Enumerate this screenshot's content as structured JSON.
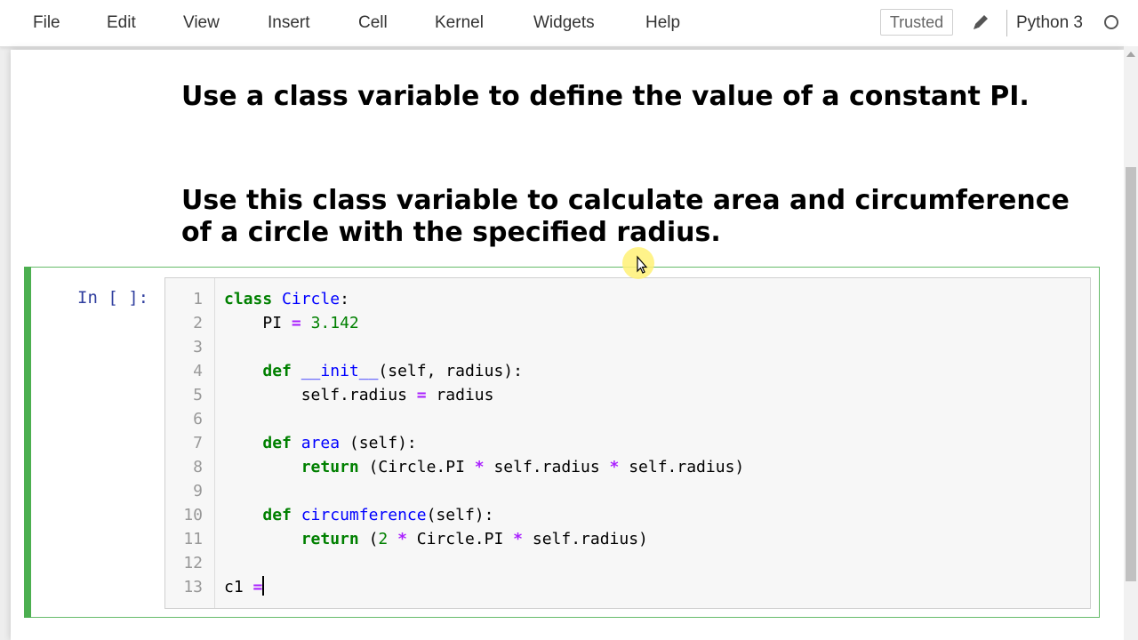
{
  "menubar": {
    "items": [
      "File",
      "Edit",
      "View",
      "Insert",
      "Cell",
      "Kernel",
      "Widgets",
      "Help"
    ],
    "trusted_label": "Trusted",
    "kernel_name": "Python 3"
  },
  "markdown": {
    "heading1": "Use a class variable to define the value of a constant PI.",
    "heading2": "Use this class variable to calculate area and circumference of a circle with the specified radius."
  },
  "cell": {
    "prompt": "In [ ]:",
    "line_numbers": [
      "1",
      "2",
      "3",
      "4",
      "5",
      "6",
      "7",
      "8",
      "9",
      "10",
      "11",
      "12",
      "13"
    ],
    "code": {
      "l1_kw": "class",
      "l1_name": "Circle",
      "l1_rest": ":",
      "l2_var": "PI",
      "l2_op": "=",
      "l2_num": "3.142",
      "l4_kw": "def",
      "l4_name": "__init__",
      "l4_rest": "(self, radius):",
      "l5_a": "self.radius",
      "l5_op": "=",
      "l5_b": "radius",
      "l7_kw": "def",
      "l7_name": "area",
      "l7_rest": " (self):",
      "l8_kw": "return",
      "l8_a": " (Circle.PI ",
      "l8_op1": "*",
      "l8_b": " self.radius ",
      "l8_op2": "*",
      "l8_c": " self.radius)",
      "l10_kw": "def",
      "l10_name": "circumference",
      "l10_rest": "(self):",
      "l11_kw": "return",
      "l11_a": " (",
      "l11_num": "2",
      "l11_op1": "*",
      "l11_b": " Circle.PI ",
      "l11_op2": "*",
      "l11_c": " self.radius)",
      "l13_a": "c1 ",
      "l13_op": "="
    }
  },
  "colors": {
    "cell_border": "#66bb6a",
    "cell_bar": "#4caf50",
    "prompt": "#303f9f",
    "keyword": "#008000",
    "function": "#0000ff",
    "operator": "#aa22ff"
  },
  "icons": {
    "edit": "pencil-icon",
    "kernel_status": "kernel-idle-circle-icon",
    "mouse": "mouse-pointer-icon"
  }
}
